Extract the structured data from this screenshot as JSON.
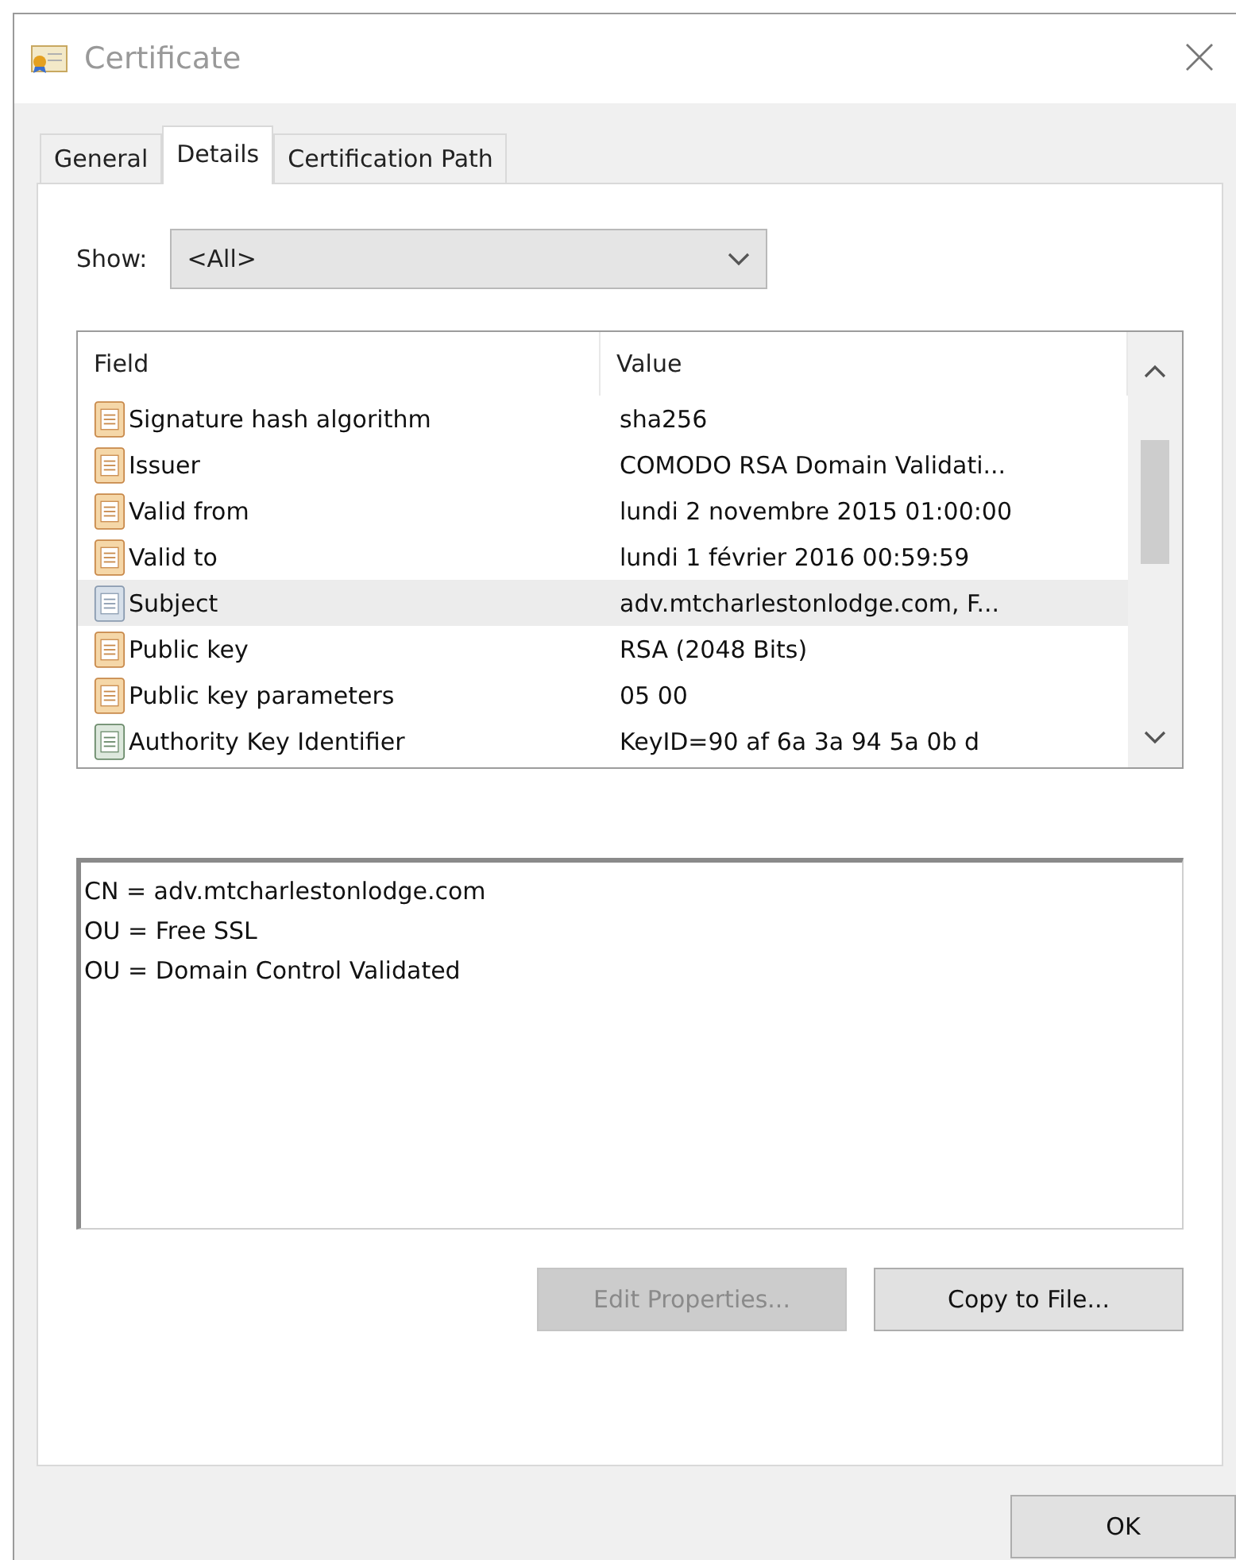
{
  "window": {
    "title": "Certificate"
  },
  "tabs": [
    {
      "label": "General",
      "selected": false
    },
    {
      "label": "Details",
      "selected": true
    },
    {
      "label": "Certification Path",
      "selected": false
    }
  ],
  "show": {
    "label": "Show:",
    "value": "<All>"
  },
  "table": {
    "columns": [
      "Field",
      "Value"
    ],
    "rows": [
      {
        "field": "Signature hash algorithm",
        "value": "sha256",
        "kind": "property",
        "selected": false
      },
      {
        "field": "Issuer",
        "value": "COMODO RSA Domain Validati...",
        "kind": "property",
        "selected": false
      },
      {
        "field": "Valid from",
        "value": "lundi 2 novembre 2015 01:00:00",
        "kind": "property",
        "selected": false
      },
      {
        "field": "Valid to",
        "value": "lundi 1 février 2016 00:59:59",
        "kind": "property",
        "selected": false
      },
      {
        "field": "Subject",
        "value": "adv.mtcharlestonlodge.com, F...",
        "kind": "subject",
        "selected": true
      },
      {
        "field": "Public key",
        "value": "RSA (2048 Bits)",
        "kind": "property",
        "selected": false
      },
      {
        "field": "Public key parameters",
        "value": "05 00",
        "kind": "property",
        "selected": false
      },
      {
        "field": "Authority Key Identifier",
        "value": "KeyID=90 af 6a 3a 94 5a 0b d",
        "kind": "extension",
        "selected": false
      }
    ]
  },
  "detail": [
    "CN = adv.mtcharlestonlodge.com",
    "OU = Free SSL",
    "OU = Domain Control Validated"
  ],
  "buttons": [
    {
      "label": "Edit Properties...",
      "disabled": true
    },
    {
      "label": "Copy to File...",
      "disabled": false
    }
  ],
  "ok": "OK"
}
